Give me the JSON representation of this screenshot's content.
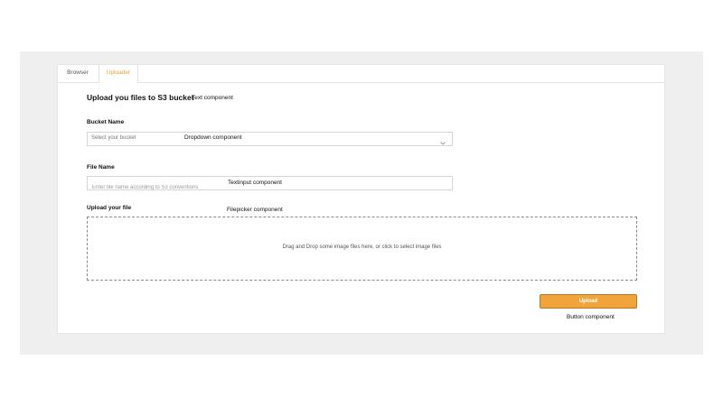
{
  "tabs": [
    {
      "label": "Browser"
    },
    {
      "label": "Uploader"
    }
  ],
  "accent_color": "#f2a43a",
  "form": {
    "title": "Upload you files to S3 bucket",
    "bucket_label": "Bucket Name",
    "bucket_placeholder": "Select your bucket",
    "file_name_label": "File Name",
    "file_name_placeholder": "Enter file name according to S3 conventions",
    "upload_file_label": "Upload your file",
    "dropzone_text": "Drag and Drop some image files here, or click to select image files",
    "upload_button": "Upload"
  },
  "annotations": {
    "text": "Text component",
    "dropdown": "Dropdown component",
    "textinput": "Textinput component",
    "filepicker": "Filepicker component",
    "button": "Button component"
  },
  "icons": {
    "dropdown": "chevron-down-icon"
  }
}
